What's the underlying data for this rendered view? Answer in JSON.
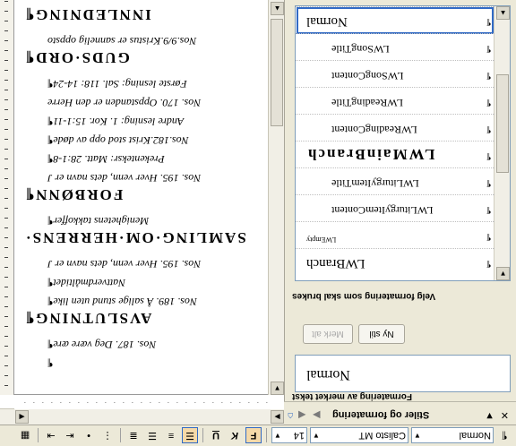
{
  "toolbar": {
    "style_value": "Normal",
    "font_value": "Calisto MT",
    "size_value": "14",
    "bold_label": "F",
    "italic_label": "K",
    "underline_label": "U"
  },
  "task_pane": {
    "title": "Stiler og formatering",
    "selected_label": "Formatering av merket tekst",
    "selected_value": "Normal",
    "new_style_button": "Ny stil",
    "select_all_button": "Merk alt",
    "choose_label": "Velg formatering som skal brukes",
    "styles": [
      {
        "name": "Normal",
        "selected": true
      },
      {
        "name": "LWSongTitle"
      },
      {
        "name": "LWSongContent"
      },
      {
        "name": "LWReadingTitle"
      },
      {
        "name": "LWReadingContent"
      },
      {
        "name": "LWMainBranch"
      },
      {
        "name": "LWLiturgyItemTitle"
      },
      {
        "name": "LWLiturgyItemContent"
      },
      {
        "name": "LWEmpty"
      },
      {
        "name": "LWBranch"
      }
    ]
  },
  "document": {
    "lines": [
      {
        "text": "INNLEDNING¶",
        "kind": "heading"
      },
      {
        "text": "Nos.9/9.Kristus er sannelig oppsto",
        "kind": "body"
      },
      {
        "text": "GUDS·ORD¶",
        "kind": "heading"
      },
      {
        "text": "Første lesning: Sal. 118: 14-24¶",
        "kind": "body"
      },
      {
        "text": "Nos. 170. Oppstanden er den Herre",
        "kind": "body"
      },
      {
        "text": "Andre lesning: 1. Kor. 15:1-11¶",
        "kind": "body"
      },
      {
        "text": "Nos.182.Krist stod opp av døde¶",
        "kind": "body"
      },
      {
        "text": "Prekenteksr: Matt. 28:1-8¶",
        "kind": "body"
      },
      {
        "text": "Nos. 195. Hver venn, dets navn er J",
        "kind": "body"
      },
      {
        "text": "FORBØNN¶",
        "kind": "heading"
      },
      {
        "text": "Menighetens takkoffer¶",
        "kind": "body"
      },
      {
        "text": "SAMLING·OM·HERRENS·",
        "kind": "heading"
      },
      {
        "text": "Nos. 195. Hver venn, dets navn er J",
        "kind": "body"
      },
      {
        "text": "Nattverdmåltidet¶",
        "kind": "body"
      },
      {
        "text": "Nos. 189. Å salige stund uten like¶",
        "kind": "body"
      },
      {
        "text": "AVSLUTNING¶",
        "kind": "heading"
      },
      {
        "text": "Nos. 187. Deg være ære¶",
        "kind": "body"
      },
      {
        "text": "¶",
        "kind": "body"
      }
    ]
  }
}
